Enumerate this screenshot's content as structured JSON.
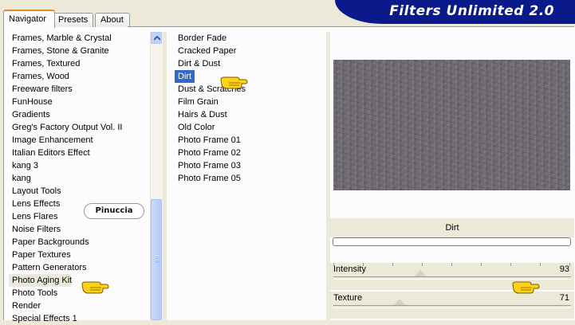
{
  "tabs": [
    {
      "label": "Navigator",
      "active": true
    },
    {
      "label": "Presets",
      "active": false
    },
    {
      "label": "About",
      "active": false
    }
  ],
  "banner": {
    "title": "Filters Unlimited 2.0"
  },
  "categories": [
    "Frames, Marble & Crystal",
    "Frames, Stone & Granite",
    "Frames, Textured",
    "Frames, Wood",
    "Freeware filters",
    "FunHouse",
    "Gradients",
    "Greg's Factory Output Vol. II",
    "Image Enhancement",
    "Italian Editors Effect",
    "kang 3",
    "kang",
    "Layout Tools",
    "Lens Effects",
    "Lens Flares",
    "Noise Filters",
    "Paper Backgrounds",
    "Paper Textures",
    "Pattern Generators",
    "Photo Aging Kit",
    "Photo Tools",
    "Render",
    "Special Effects 1"
  ],
  "selected_category": "Photo Aging Kit",
  "filters": [
    "Border Fade",
    "Cracked Paper",
    "Dirt & Dust",
    "Dirt",
    "Dust & Scratches",
    "Film Grain",
    "Hairs & Dust",
    "Old Color",
    "Photo Frame 01",
    "Photo Frame 02",
    "Photo Frame 03",
    "Photo Frame 05"
  ],
  "selected_filter": "Dirt",
  "filter_name": "Dirt",
  "sliders": [
    {
      "label": "Intensity",
      "value": "93",
      "level": 0.365
    },
    {
      "label": "Texture",
      "value": "71",
      "level": 0.278
    }
  ],
  "watermark": "Pinuccia",
  "colors": {
    "banner": "#0b1a8a",
    "selection": "#316ac5",
    "tab_accent": "#e68b2c"
  }
}
